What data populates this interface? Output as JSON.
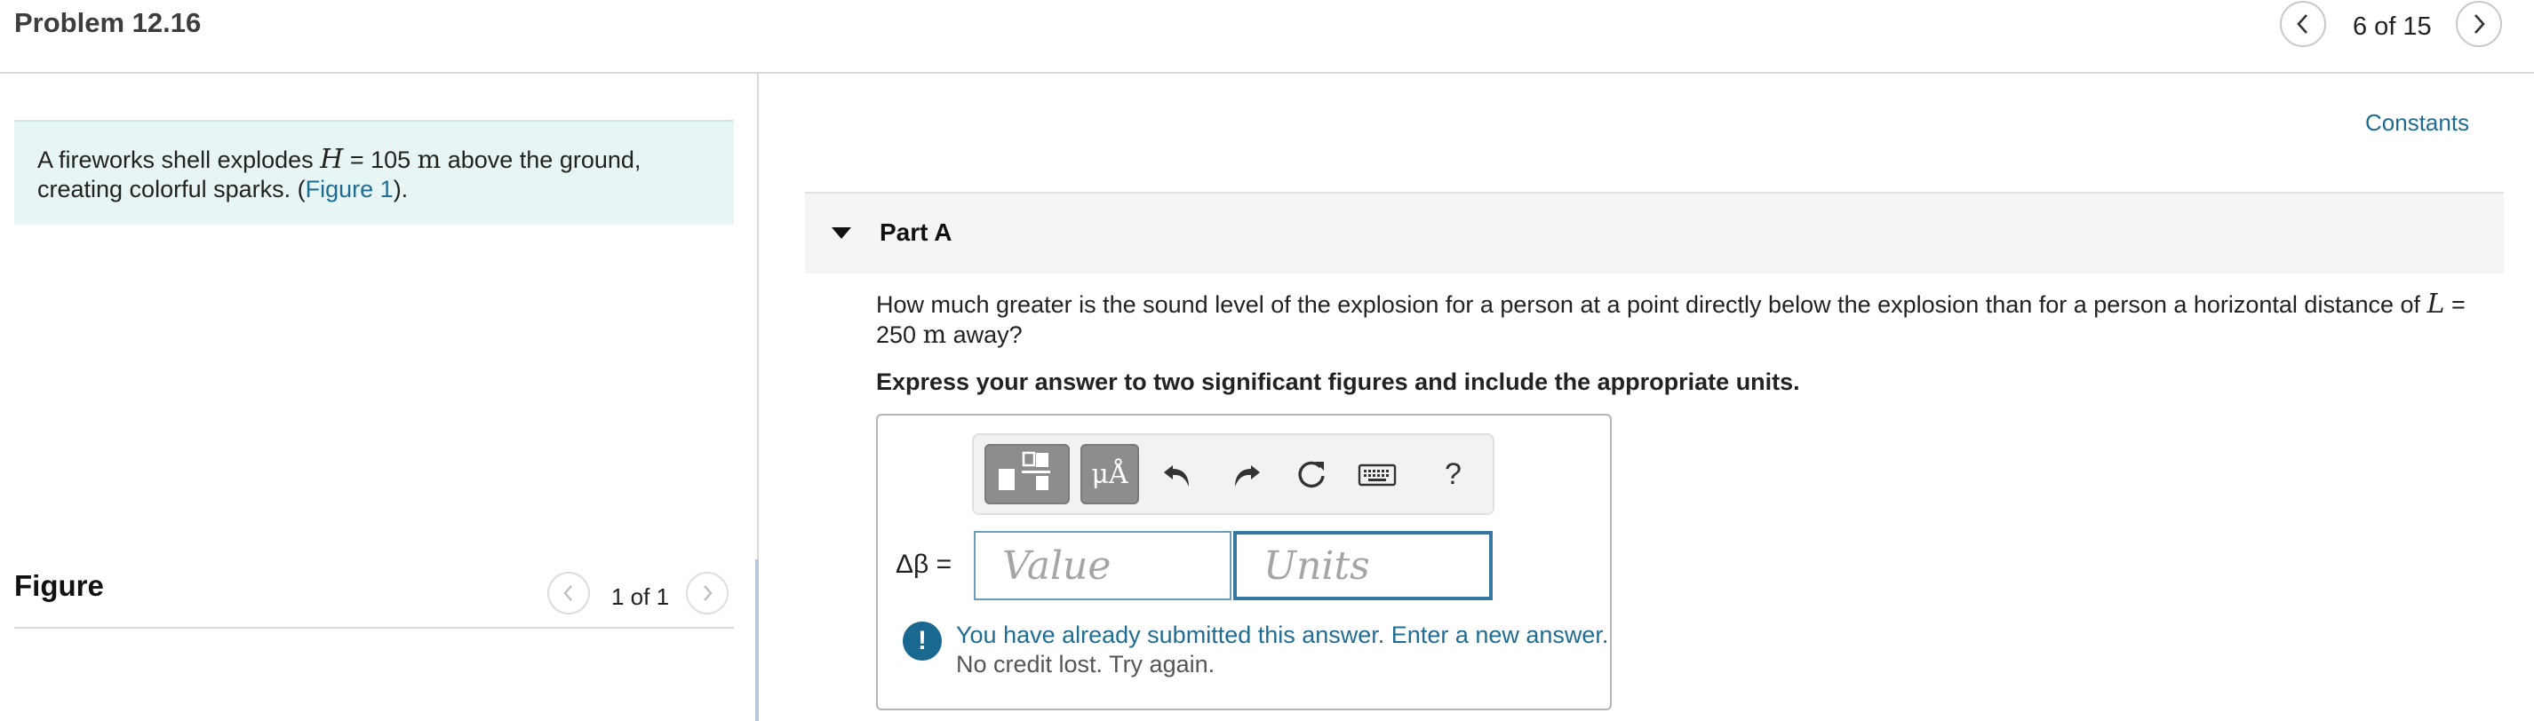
{
  "header": {
    "title": "Problem 12.16",
    "page_indicator": "6 of 15"
  },
  "problem": {
    "text_before": "A fireworks shell explodes ",
    "var_H": "H",
    "eq_H": " = 105 ",
    "unit_H": "m",
    "text_after": " above the ground, creating colorful sparks. (",
    "figure_link": "Figure 1",
    "text_end": ")."
  },
  "figure": {
    "heading": "Figure",
    "page_indicator": "1 of 1"
  },
  "constants_link": "Constants",
  "part_a": {
    "label": "Part A",
    "question_before": "How much greater is the sound level of the explosion for a person at a point directly below the explosion than for a person a horizontal distance of ",
    "var_L": "L",
    "eq_L": " = 250 ",
    "unit_L": "m",
    "question_after": " away?",
    "instruction": "Express your answer to two significant figures and include the appropriate units.",
    "answer_label": "Δβ =",
    "value_placeholder": "Value",
    "units_placeholder": "Units",
    "units_tool_label": "μÅ",
    "help_label": "?",
    "feedback_line1": "You have already submitted this answer. Enter a new answer.",
    "feedback_line2": "No credit lost. Try again.",
    "feedback_icon": "!"
  },
  "icons": {
    "prev": "chevron-left-icon",
    "next": "chevron-right-icon",
    "undo": "undo-icon",
    "redo": "redo-icon",
    "reset": "reset-icon",
    "keyboard": "keyboard-icon",
    "templates": "templates-icon"
  },
  "colors": {
    "link": "#1f6d93",
    "problem_bg": "#e8f5f5",
    "input_border": "#3577a0",
    "feedback_icon": "#19688f"
  }
}
